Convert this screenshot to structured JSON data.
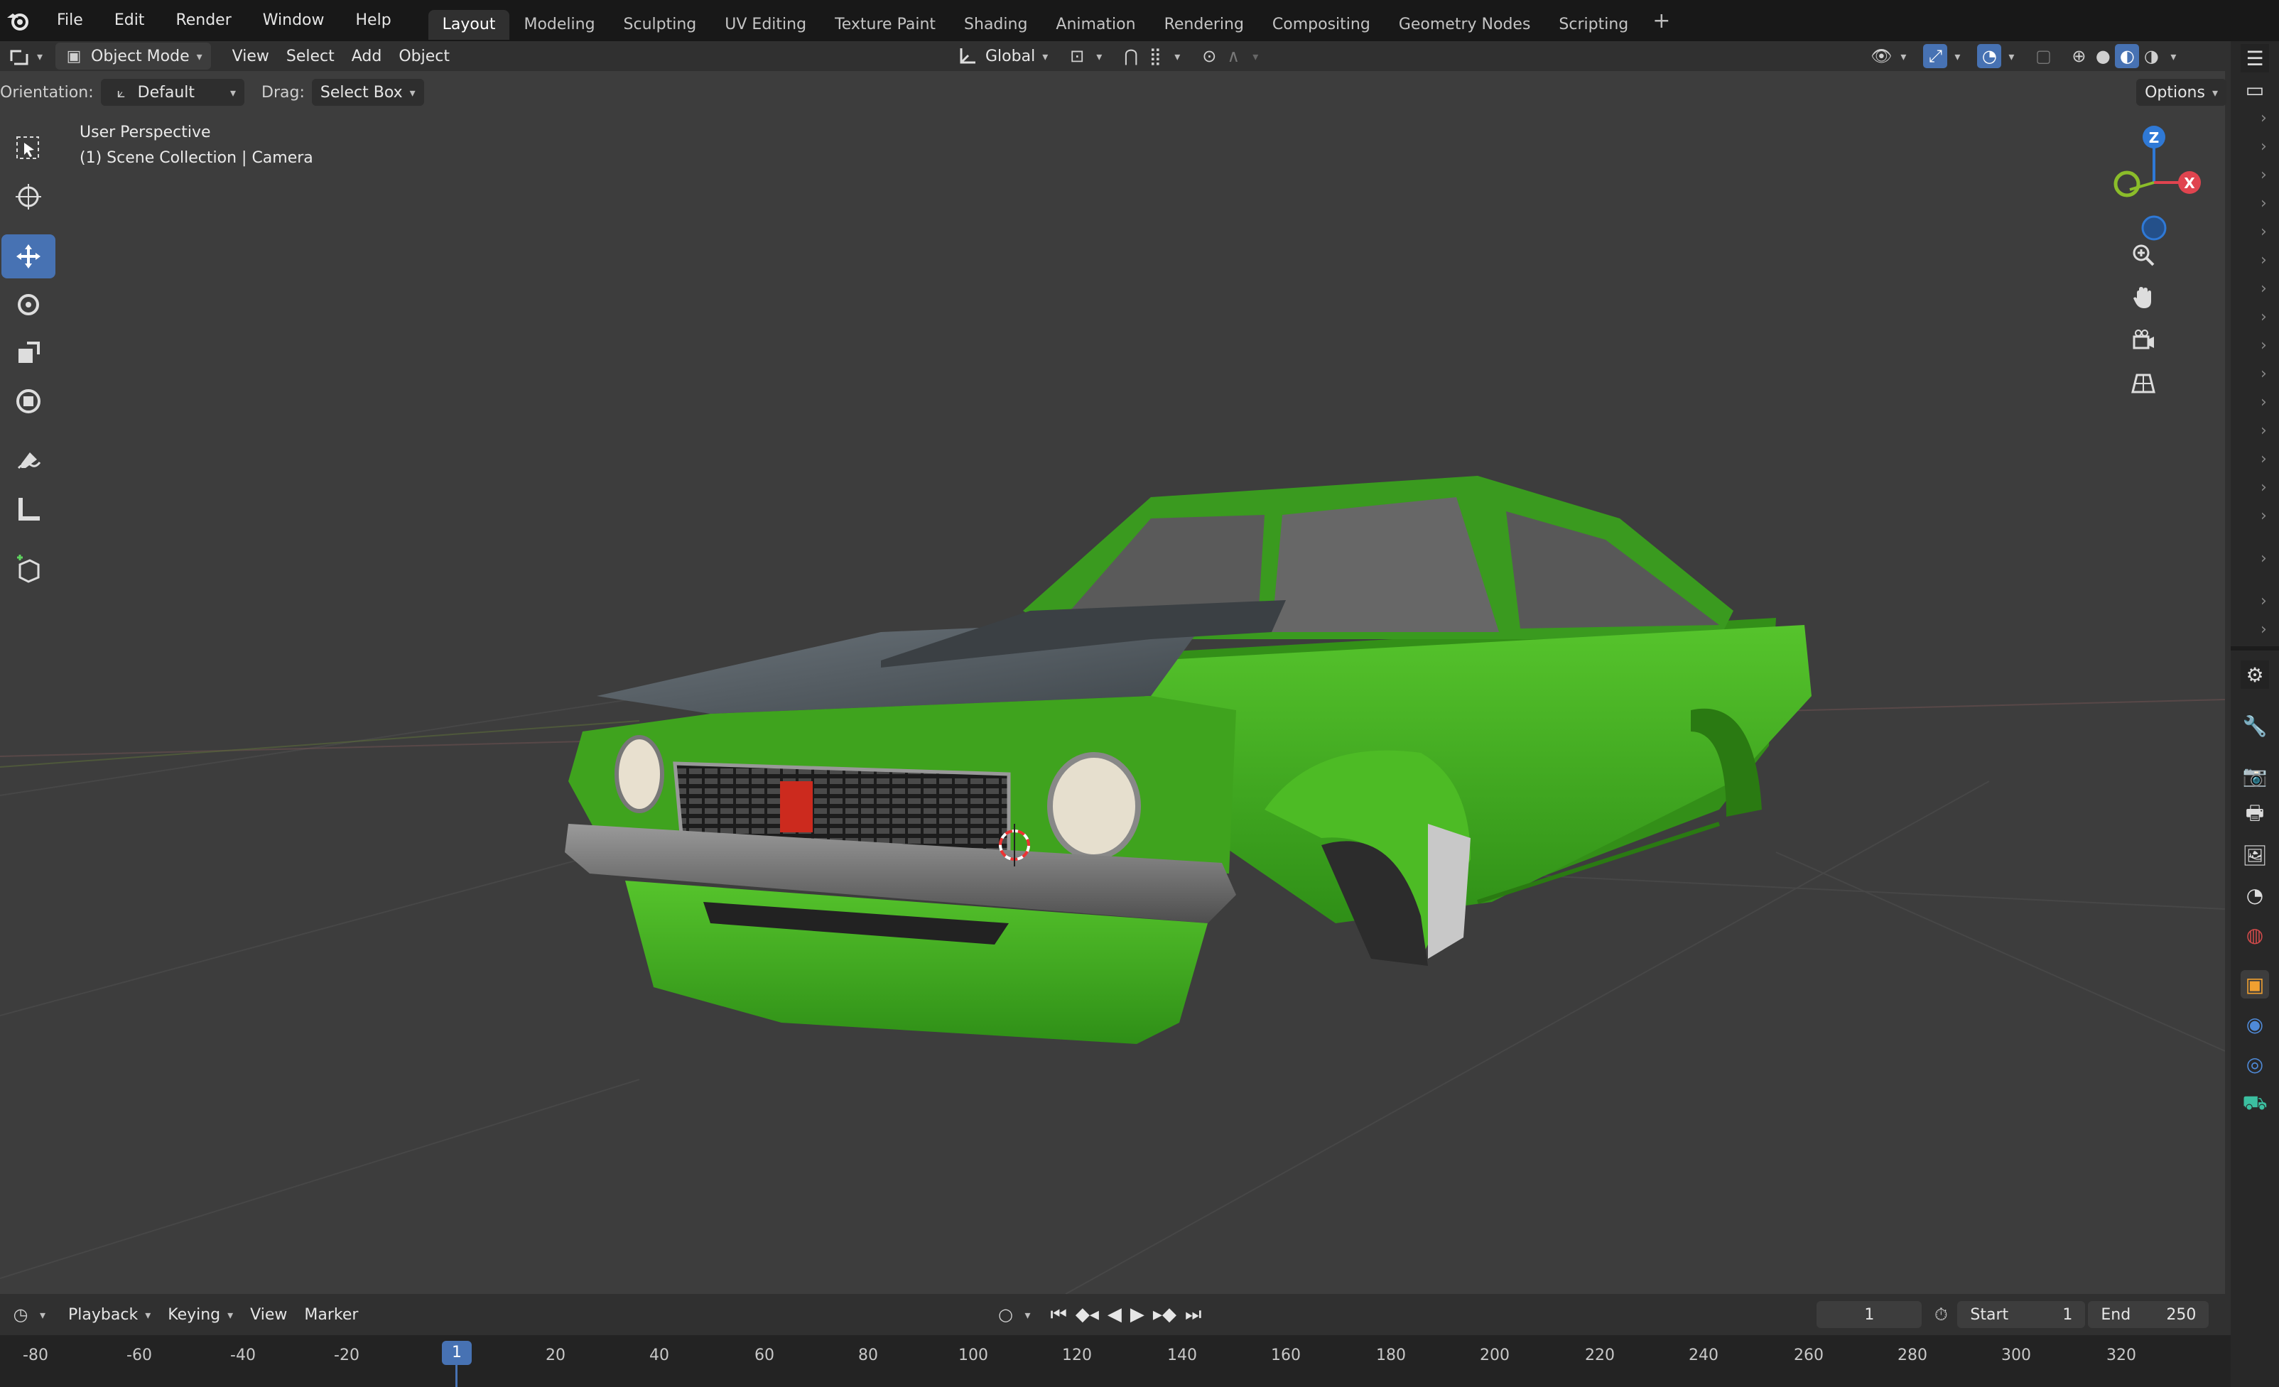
{
  "menu": {
    "items": [
      "File",
      "Edit",
      "Render",
      "Window",
      "Help"
    ]
  },
  "workspaces": {
    "tabs": [
      "Layout",
      "Modeling",
      "Sculpting",
      "UV Editing",
      "Texture Paint",
      "Shading",
      "Animation",
      "Rendering",
      "Compositing",
      "Geometry Nodes",
      "Scripting"
    ],
    "active": "Layout"
  },
  "header": {
    "mode": "Object Mode",
    "menus": [
      "View",
      "Select",
      "Add",
      "Object"
    ],
    "transform_orientation": "Global"
  },
  "subheader": {
    "orientation_label": "Orientation:",
    "orientation_value": "Default",
    "drag_label": "Drag:",
    "drag_value": "Select Box",
    "options_label": "Options"
  },
  "viewport": {
    "view_name": "User Perspective",
    "context": "(1) Scene Collection | Camera",
    "axes": {
      "x": "X",
      "z": "Z"
    },
    "axis_colors": {
      "x": "#e0444f",
      "y": "#8bbd2a",
      "z": "#2f79d6"
    },
    "car_color": "#3fa31e"
  },
  "timeline": {
    "menus": [
      "Playback",
      "Keying",
      "View",
      "Marker"
    ],
    "current_frame": "1",
    "start_label": "Start",
    "start_value": "1",
    "end_label": "End",
    "end_value": "250",
    "ruler": [
      "-80",
      "-60",
      "-40",
      "-20",
      "1",
      "20",
      "40",
      "60",
      "80",
      "100",
      "120",
      "140",
      "160",
      "180",
      "200",
      "220",
      "240",
      "260",
      "280",
      "300",
      "320"
    ]
  },
  "colors": {
    "accent": "#4772b3",
    "background": "#303030",
    "viewport_bg": "#3d3d3d"
  }
}
